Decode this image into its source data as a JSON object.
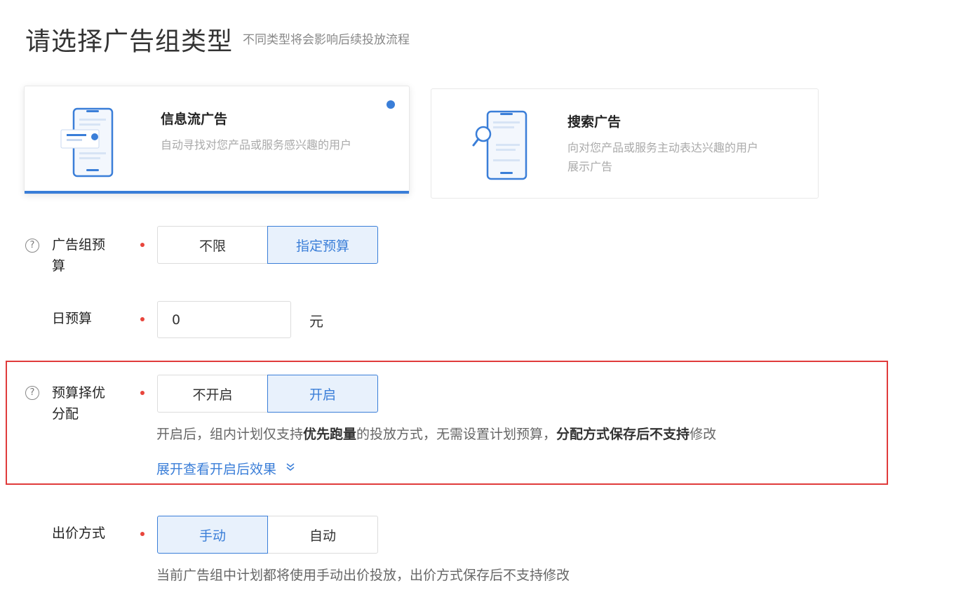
{
  "header": {
    "title": "请选择广告组类型",
    "subtitle": "不同类型将会影响后续投放流程"
  },
  "ad_types": [
    {
      "title": "信息流广告",
      "desc": "自动寻找对您产品或服务感兴趣的用户",
      "selected": true
    },
    {
      "title": "搜索广告",
      "desc_line1": "向对您产品或服务主动表达兴趣的用户",
      "desc_line2": "展示广告",
      "selected": false
    }
  ],
  "budget": {
    "label_line1": "广告组预",
    "label_line2": "算",
    "options": [
      "不限",
      "指定预算"
    ],
    "selected": "指定预算"
  },
  "daily_budget": {
    "label": "日预算",
    "value": "0",
    "unit": "元"
  },
  "budget_optimize": {
    "label_line1": "预算择优",
    "label_line2": "分配",
    "options": [
      "不开启",
      "开启"
    ],
    "selected": "开启",
    "hint_part1": "开启后，组内计划仅支持",
    "hint_bold1": "优先跑量",
    "hint_part2": "的投放方式，无需设置计划预算，",
    "hint_bold2": "分配方式保存后不支持",
    "hint_part3": "修改",
    "expand_link": "展开查看开启后效果"
  },
  "bid_method": {
    "label": "出价方式",
    "options": [
      "手动",
      "自动"
    ],
    "selected": "手动",
    "hint": "当前广告组中计划都将使用手动出价投放，出价方式保存后不支持修改"
  },
  "colors": {
    "accent": "#3a7ed8",
    "required": "#e8453c",
    "highlight_border": "#e03b3b"
  }
}
